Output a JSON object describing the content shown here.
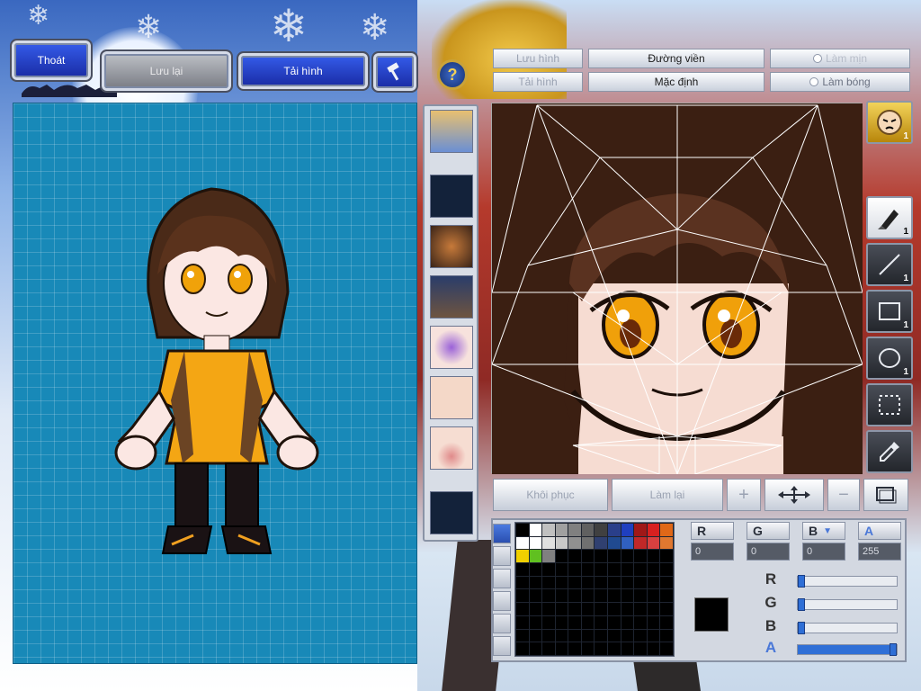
{
  "header": {
    "exit_label": "Thoát",
    "save_label": "Lưu lại",
    "reload_label": "Tải hình",
    "hammer_icon": "hammer-icon",
    "help_icon": "question-icon",
    "help_glyph": "?"
  },
  "editor_toolbar": {
    "save_image": "Lưu hình",
    "load_image": "Tải hình",
    "outline": "Đường viền",
    "default": "Mặc định",
    "smooth": "Làm mịn",
    "shade": "Làm bóng"
  },
  "parts": [
    {
      "name": "face-preview",
      "kind": "face"
    },
    {
      "name": "empty-slot",
      "kind": "empty"
    },
    {
      "name": "hair-preview",
      "kind": "hair"
    },
    {
      "name": "body-preview",
      "kind": "body"
    },
    {
      "name": "eyes-preview",
      "kind": "eyes"
    },
    {
      "name": "skin-preview",
      "kind": "skin"
    },
    {
      "name": "mouth-preview",
      "kind": "mouth"
    },
    {
      "name": "empty-slot",
      "kind": "empty"
    }
  ],
  "tools": {
    "face_count": "1",
    "pen_count": "1",
    "line_count": "1",
    "rect_count": "1",
    "ellipse_count": "1"
  },
  "bottom_bar": {
    "restore": "Khôi phục",
    "redo": "Làm lại"
  },
  "color": {
    "r_label": "R",
    "g_label": "G",
    "b_label": "B",
    "a_label": "A",
    "r": "0",
    "g": "0",
    "b": "0",
    "a": "255",
    "selected_hex": "#000000",
    "r_level": 0.0,
    "g_level": 0.0,
    "b_level": 0.0,
    "a_level": 1.0
  },
  "palette": {
    "row1": [
      "#000000",
      "#ffffff",
      "#c0c0c0",
      "#a0a0a0",
      "#808080",
      "#606060",
      "#404040",
      "#2a3f8a",
      "#1f3fbf",
      "#a01818",
      "#d82020",
      "#e06818",
      "#e08a10",
      "#f0b020"
    ],
    "row2": [
      "#ffffff",
      "#ffffff",
      "#e0e0e0",
      "#c8c8c8",
      "#909090",
      "#707070",
      "#304070",
      "#204a90",
      "#3060c0",
      "#c02828",
      "#d84040",
      "#e07830",
      "#e8a040",
      "#f0c040"
    ],
    "row3": [
      "#f0d000",
      "#60c020",
      "#808080"
    ]
  }
}
